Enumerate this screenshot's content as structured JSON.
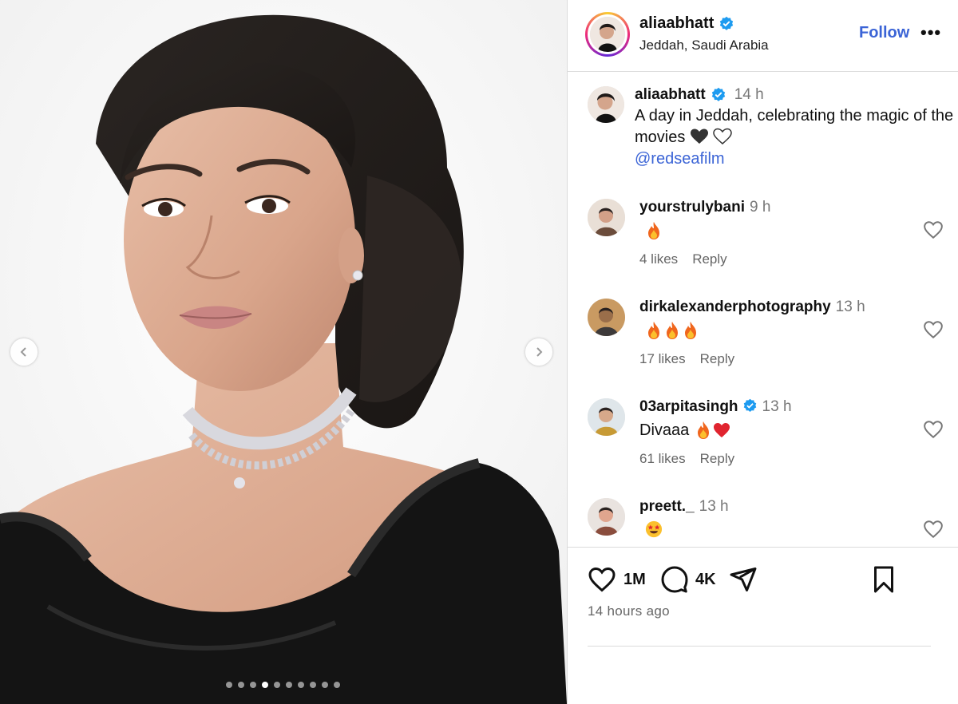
{
  "post": {
    "username": "aliaabhatt",
    "location": "Jeddah, Saudi Arabia",
    "follow_label": "Follow",
    "more_label": "•••",
    "caption": {
      "username": "aliaabhatt",
      "time": "14 h",
      "text": "A day in Jeddah, celebrating the magic of the movies",
      "mention": "@redseafilm"
    },
    "carousel": {
      "total": 10,
      "active_index": 3
    }
  },
  "comments": [
    {
      "username": "yourstrulybani",
      "verified": false,
      "time": "9 h",
      "text": "",
      "emojis": [
        "fire"
      ],
      "likes": "4 likes",
      "reply": "Reply"
    },
    {
      "username": "dirkalexanderphotography",
      "verified": false,
      "time": "13 h",
      "text": "",
      "emojis": [
        "fire",
        "fire",
        "fire"
      ],
      "likes": "17 likes",
      "reply": "Reply"
    },
    {
      "username": "03arpitasingh",
      "verified": true,
      "time": "13 h",
      "text": "Divaaa",
      "emojis": [
        "fire",
        "red-heart"
      ],
      "likes": "61 likes",
      "reply": "Reply"
    },
    {
      "username": "preett._",
      "verified": false,
      "time": "13 h",
      "text": "",
      "emojis": [
        "star-struck"
      ],
      "likes": "",
      "reply": ""
    }
  ],
  "actions": {
    "like_count": "1M",
    "comment_count": "4K",
    "posted_ago": "14 hours ago"
  },
  "colors": {
    "link": "#3b64d6",
    "verified": "#1d9bf0",
    "muted_text": "#777777"
  },
  "icons": [
    "chevron-left-icon",
    "chevron-right-icon",
    "verified-badge-icon",
    "heart-icon",
    "comment-icon",
    "share-icon",
    "bookmark-icon"
  ]
}
